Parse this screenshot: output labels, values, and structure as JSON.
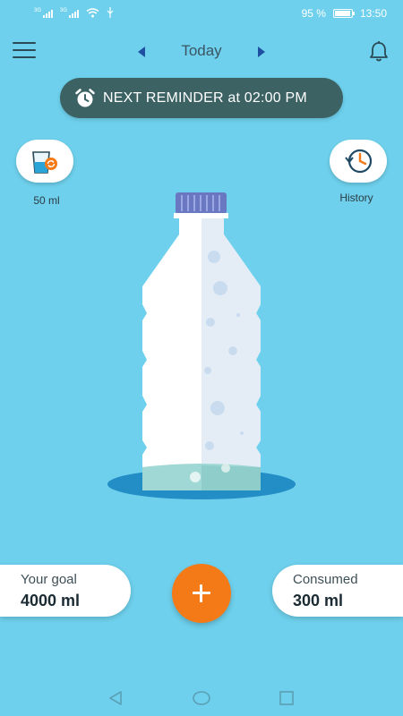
{
  "status_bar": {
    "signal1_label": "3G",
    "signal2_label": "3G",
    "battery_percent": "95 %",
    "battery_level": 0.95,
    "time": "13:50"
  },
  "header": {
    "day": "Today"
  },
  "reminder": {
    "text": "NEXT REMINDER at 02:00 PM"
  },
  "cup": {
    "label": "50 ml"
  },
  "history": {
    "label": "History"
  },
  "bottle": {
    "fill_level": 0.075
  },
  "goal": {
    "label": "Your goal",
    "value": "4000 ml"
  },
  "consumed": {
    "label": "Consumed",
    "value": "300 ml"
  },
  "colors": {
    "background": "#6ed0ec",
    "reminder_bg": "#3d6264",
    "add_button": "#f47a17",
    "accent_blue": "#1f4fa0"
  },
  "icons": [
    "menu-icon",
    "arrow-left-icon",
    "arrow-right-icon",
    "bell-icon",
    "alarm-clock-icon",
    "glass-icon",
    "history-clock-icon",
    "plus-icon",
    "back-icon",
    "home-icon",
    "recent-apps-icon"
  ]
}
